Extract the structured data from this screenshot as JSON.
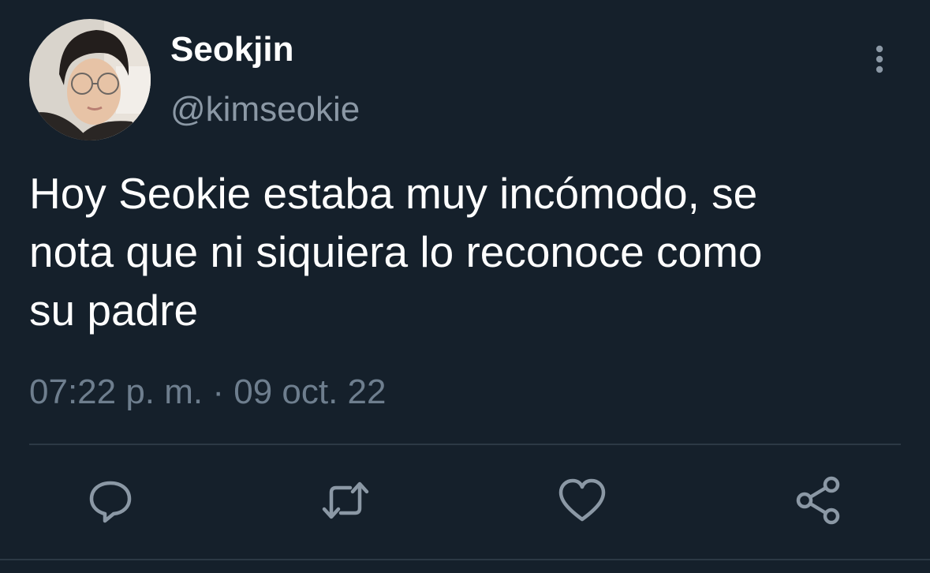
{
  "user": {
    "display_name": "Seokjin",
    "handle": "@kimseokie",
    "avatar_icon": "profile-photo"
  },
  "tweet": {
    "text": "Hoy Seokie estaba muy incómodo, se\nnota que ni siquiera lo reconoce como\nsu padre",
    "timestamp": "07:22 p. m. · 09 oct. 22"
  },
  "actions": {
    "more_icon": "more-vertical-icon",
    "reply_icon": "reply-icon",
    "retweet_icon": "retweet-icon",
    "like_icon": "heart-icon",
    "share_icon": "share-icon"
  },
  "colors": {
    "background": "#15202b",
    "primary_text": "#ffffff",
    "secondary_text": "#8b98a5",
    "icon": "#8b98a5",
    "divider": "#2c3945"
  }
}
